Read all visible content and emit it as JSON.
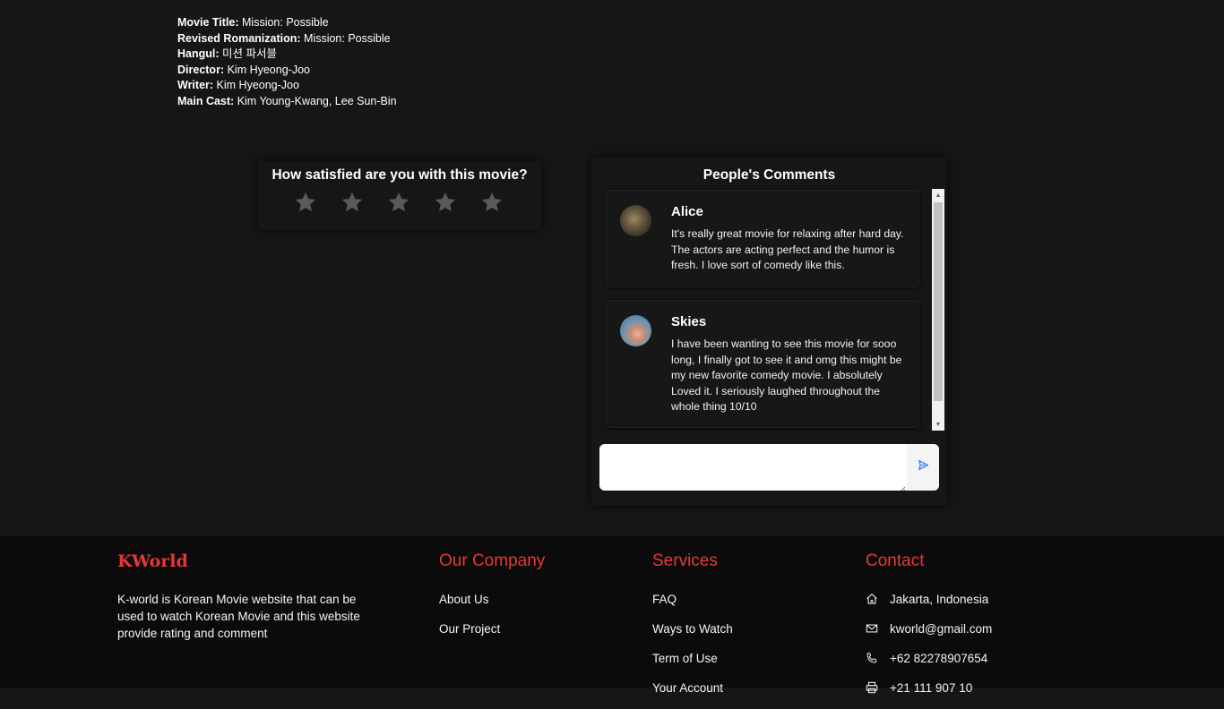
{
  "movie_info": {
    "title_label": "Movie Title:",
    "title_value": "Mission: Possible",
    "romanization_label": "Revised Romanization:",
    "romanization_value": "Mission: Possible",
    "hangul_label": "Hangul:",
    "hangul_value": "미션 파서블",
    "director_label": "Director:",
    "director_value": "Kim Hyeong-Joo",
    "writer_label": "Writer:",
    "writer_value": "Kim Hyeong-Joo",
    "cast_label": "Main Cast:",
    "cast_value": "Kim Young-Kwang, Lee Sun-Bin"
  },
  "rating": {
    "title": "How satisfied are you with this movie?",
    "stars_total": 5,
    "stars_selected": 0,
    "star_color": "#5a5a5a"
  },
  "comments": {
    "title": "People's Comments",
    "items": [
      {
        "name": "Alice",
        "text": "It's really great movie for relaxing after hard day. The actors are acting perfect and the humor is fresh. I love sort of comedy like this."
      },
      {
        "name": "Skies",
        "text": "I have been wanting to see this movie for sooo long, I finally got to see it and omg this might be my new favorite comedy movie. I absolutely Loved it. I seriously laughed throughout the whole thing 10/10"
      }
    ],
    "input_placeholder": "",
    "input_value": ""
  },
  "footer": {
    "brand": "KWorld",
    "description": "K-world is Korean Movie website that can be used to watch Korean Movie and this website provide rating and comment",
    "company": {
      "heading": "Our Company",
      "links": [
        "About Us",
        "Our Project"
      ]
    },
    "services": {
      "heading": "Services",
      "links": [
        "FAQ",
        "Ways to Watch",
        "Term of Use",
        "Your Account"
      ]
    },
    "contact": {
      "heading": "Contact",
      "address": "Jakarta, Indonesia",
      "email": "kworld@gmail.com",
      "phone": "+62 82278907654",
      "fax": "+21 111 907 10"
    },
    "accent_color": "#e53935"
  }
}
